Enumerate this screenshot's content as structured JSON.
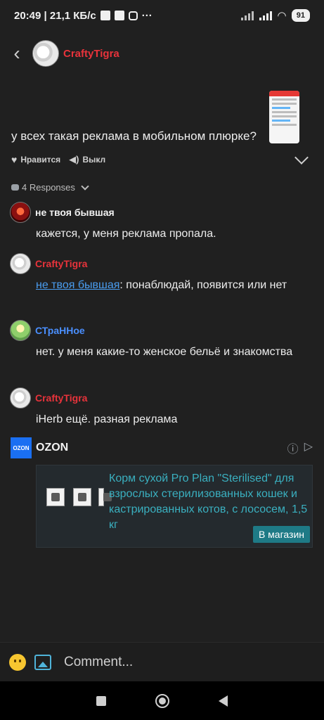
{
  "status_bar": {
    "time_net": "20:49 | 21,1 КБ/с",
    "battery": "91"
  },
  "header": {
    "author": "CraftyTigra"
  },
  "post": {
    "text": "у всех такая реклама в мобильном плюрке?",
    "like_label": "Нравится",
    "mute_label": "Выкл"
  },
  "responses": {
    "label": "4 Responses"
  },
  "comments": [
    {
      "author": "не твоя бывшая",
      "text": "кажется, у меня реклама пропала."
    },
    {
      "author": "CraftyTigra",
      "mention": "не твоя бывшая",
      "text": ": понаблюдай, появится или нет"
    },
    {
      "author": "СТраННое",
      "text": "нет. у меня какие-то женское бельё и знакомства"
    },
    {
      "author": "CraftyTigra",
      "text": "iHerb ещё. разная реклама"
    }
  ],
  "ad": {
    "brand": "OZON",
    "logo_text": "OZON",
    "description": "Корм сухой Pro Plan \"Sterilised\" для взрослых стерилизованных кошек и кастрированных котов, с лососем, 1,5 кг",
    "button_label": "В магазин"
  },
  "comment_bar": {
    "placeholder": "Comment..."
  },
  "colors": {
    "author_red": "#e8333b",
    "link_blue": "#4a9df0",
    "ad_teal": "#3ab0c0",
    "ozon_blue": "#1a6ff2"
  }
}
